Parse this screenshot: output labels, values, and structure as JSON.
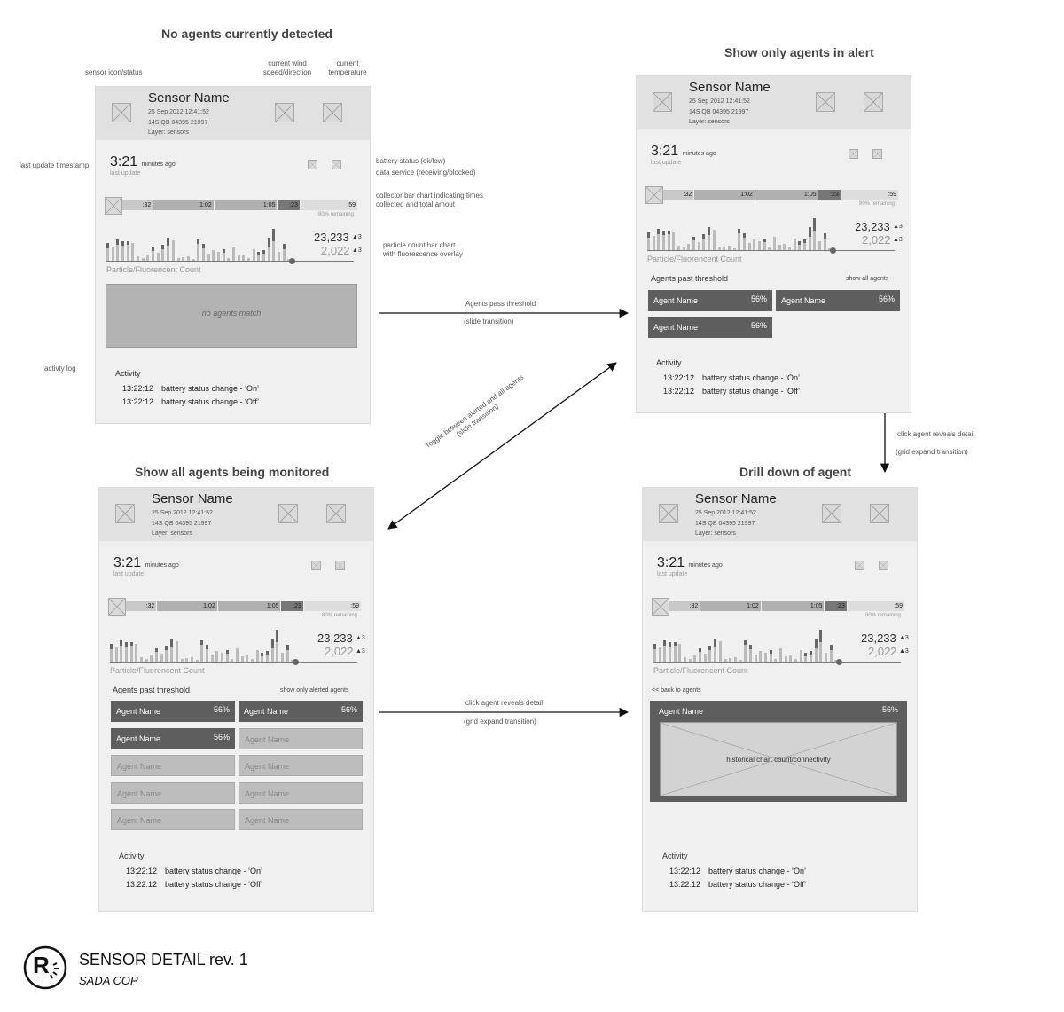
{
  "titles": {
    "none": "No agents currently detected",
    "alert": "Show only agents in alert",
    "all": "Show all agents being monitored",
    "drill": "Drill down of agent"
  },
  "annotations": {
    "sensor_icon": "sensor icon/status",
    "wind_line1": "current wind",
    "wind_line2": "speed/direction",
    "temp_line1": "current",
    "temp_line2": "temperature",
    "last_update": "last update timestamp",
    "battery": "battery status (ok/low)",
    "data_service": "data service (receiving/blocked)",
    "collector_line1": "collector bar chart indicating times",
    "collector_line2": "collected and total amout",
    "particle_line1": "particle count bar chart",
    "particle_line2": "with fluorescence overlay",
    "activity_log": "activty log"
  },
  "transitions": {
    "pass": "Agents pass threshold",
    "pass_sub": "(slide transition)",
    "toggle": "Toggle between alerted and all agents",
    "toggle_sub": "(slide transition)",
    "click_right": "click agent reveals detail",
    "click_right_sub": "(grid expand transition)",
    "click_bottom": "click agent reveals detail",
    "click_bottom_sub": "(grid expand transition)"
  },
  "sensor": {
    "name": "Sensor Name",
    "date": "25 Sep 2012 12:41:52",
    "coords": "14S QB 04395 21997",
    "layer": "Layer: sensors",
    "time": "3:21",
    "time_unit": "minutes ago",
    "last_update": "last update",
    "remaining": "80% remaining",
    "count1": "23,233",
    "count2": "2,022",
    "delta1": "▲3",
    "delta2": "▲3",
    "particle_label": "Particle/Fluorencent Count"
  },
  "collector": [
    {
      "label": ":32",
      "value": 32,
      "color": "#c8c8c8"
    },
    {
      "label": "1:02",
      "value": 62,
      "color": "#b0b0b0"
    },
    {
      "label": "1:05",
      "value": 65,
      "color": "#b0b0b0"
    },
    {
      "label": ":23",
      "value": 23,
      "color": "#777777"
    },
    {
      "label": ":59",
      "value": 59,
      "color": "#dddddd"
    }
  ],
  "particle_bars": [
    [
      14,
      6
    ],
    [
      16,
      0
    ],
    [
      18,
      6
    ],
    [
      17,
      5
    ],
    [
      18,
      4
    ],
    [
      20,
      0
    ],
    [
      5,
      0
    ],
    [
      3,
      0
    ],
    [
      7,
      0
    ],
    [
      11,
      4
    ],
    [
      9,
      0
    ],
    [
      13,
      5
    ],
    [
      17,
      9
    ],
    [
      23,
      0
    ],
    [
      3,
      0
    ],
    [
      4,
      0
    ],
    [
      5,
      0
    ],
    [
      2,
      0
    ],
    [
      19,
      5
    ],
    [
      14,
      5
    ],
    [
      8,
      0
    ],
    [
      12,
      0
    ],
    [
      10,
      0
    ],
    [
      9,
      4
    ],
    [
      3,
      0
    ],
    [
      15,
      0
    ],
    [
      6,
      0
    ],
    [
      7,
      0
    ],
    [
      3,
      0
    ],
    [
      13,
      0
    ],
    [
      6,
      4
    ],
    [
      8,
      4
    ],
    [
      15,
      11
    ],
    [
      22,
      14
    ],
    [
      10,
      0
    ],
    [
      13,
      6
    ],
    [
      2,
      0
    ]
  ],
  "panels": {
    "none": {
      "no_match": "no agents match",
      "activity_title": "Activity",
      "activity": [
        {
          "time": "13:22:12",
          "text": "battery status change  - ‘On’"
        },
        {
          "time": "13:22:12",
          "text": "battery status change  - ‘Off’"
        }
      ]
    },
    "alert": {
      "agents_title": "Agents past threshold",
      "toggle_link": "show all agents",
      "agents": [
        {
          "name": "Agent Name",
          "pct": "56%",
          "on": true
        },
        {
          "name": "Agent Name",
          "pct": "56%",
          "on": true
        },
        {
          "name": "Agent Name",
          "pct": "56%",
          "on": true
        }
      ],
      "activity_title": "Activity",
      "activity": [
        {
          "time": "13:22:12",
          "text": "battery status change  - ‘On’"
        },
        {
          "time": "13:22:12",
          "text": "battery status change  - ‘Off’"
        }
      ]
    },
    "all": {
      "agents_title": "Agents past threshold",
      "toggle_link": "show only alerted agents",
      "agents": [
        {
          "name": "Agent Name",
          "pct": "56%",
          "on": true
        },
        {
          "name": "Agent Name",
          "pct": "56%",
          "on": true
        },
        {
          "name": "Agent Name",
          "pct": "56%",
          "on": true
        },
        {
          "name": "Agent Name",
          "pct": "",
          "on": false
        },
        {
          "name": "Agent Name",
          "pct": "",
          "on": false
        },
        {
          "name": "Agent Name",
          "pct": "",
          "on": false
        },
        {
          "name": "Agent Name",
          "pct": "",
          "on": false
        },
        {
          "name": "Agent Name",
          "pct": "",
          "on": false
        },
        {
          "name": "Agent Name",
          "pct": "",
          "on": false
        },
        {
          "name": "Agent Name",
          "pct": "",
          "on": false
        }
      ],
      "activity_title": "Activity",
      "activity": [
        {
          "time": "13:22:12",
          "text": "battery status change  - ‘On’"
        },
        {
          "time": "13:22:12",
          "text": "battery status change  - ‘Off’"
        }
      ]
    },
    "drill": {
      "back_link": "<< back to agents",
      "agent_name": "Agent Name",
      "agent_pct": "56%",
      "chart_label": "historical chart count/connectivity",
      "activity_title": "Activity",
      "activity": [
        {
          "time": "13:22:12",
          "text": "battery status change  - ‘On’"
        },
        {
          "time": "13:22:12",
          "text": "battery status change  - ‘Off’"
        }
      ]
    }
  },
  "footer": {
    "logo_letter": "R",
    "title": "SENSOR DETAIL rev. 1",
    "subtitle": "SADA COP"
  }
}
